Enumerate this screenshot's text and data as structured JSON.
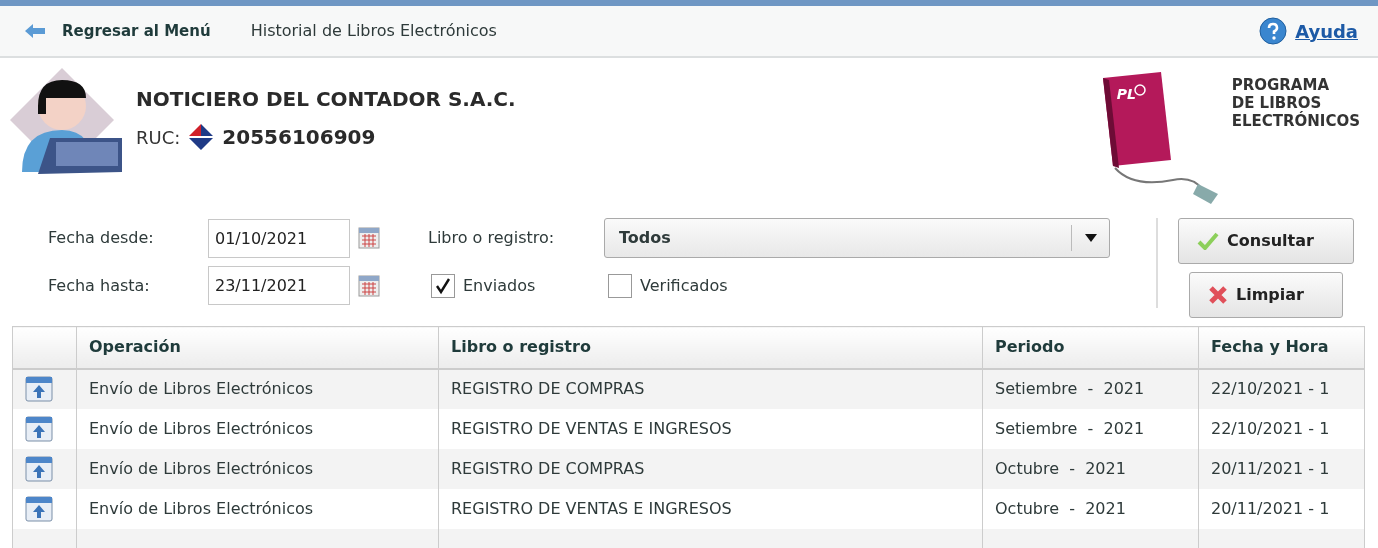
{
  "nav": {
    "back": "Regresar al Menú",
    "title": "Historial de Libros Electrónicos",
    "help": "Ayuda"
  },
  "company": {
    "name": "NOTICIERO DEL CONTADOR S.A.C.",
    "ruc_label": "RUC:",
    "ruc": "20556106909"
  },
  "logo": {
    "mark": "PL",
    "lines": [
      "PROGRAMA",
      "DE LIBROS",
      "ELECTRÓNICOS"
    ]
  },
  "filters": {
    "date_from": {
      "label": "Fecha desde:",
      "value": "01/10/2021"
    },
    "date_to": {
      "label": "Fecha hasta:",
      "value": "23/11/2021"
    },
    "book": {
      "label": "Libro o registro:",
      "value": "Todos"
    },
    "checks": [
      {
        "label": "Enviados",
        "checked": true
      },
      {
        "label": "Verificados",
        "checked": false
      }
    ]
  },
  "buttons": [
    {
      "label": "Consultar",
      "kind": "confirm"
    },
    {
      "label": "Limpiar",
      "kind": "clear"
    }
  ],
  "table": {
    "columns": [
      "Operación",
      "Libro o registro",
      "Periodo",
      "Fecha y Hora"
    ],
    "rows": [
      [
        "Envío de Libros Electrónicos",
        "REGISTRO DE COMPRAS",
        "Setiembre  -  2021",
        "22/10/2021 - 1"
      ],
      [
        "Envío de Libros Electrónicos",
        "REGISTRO DE VENTAS E INGRESOS",
        "Setiembre  -  2021",
        "22/10/2021 - 1"
      ],
      [
        "Envío de Libros Electrónicos",
        "REGISTRO DE COMPRAS",
        "Octubre  -  2021",
        "20/11/2021 - 1"
      ],
      [
        "Envío de Libros Electrónicos",
        "REGISTRO DE VENTAS E INGRESOS",
        "Octubre  -  2021",
        "20/11/2021 - 1"
      ]
    ]
  }
}
